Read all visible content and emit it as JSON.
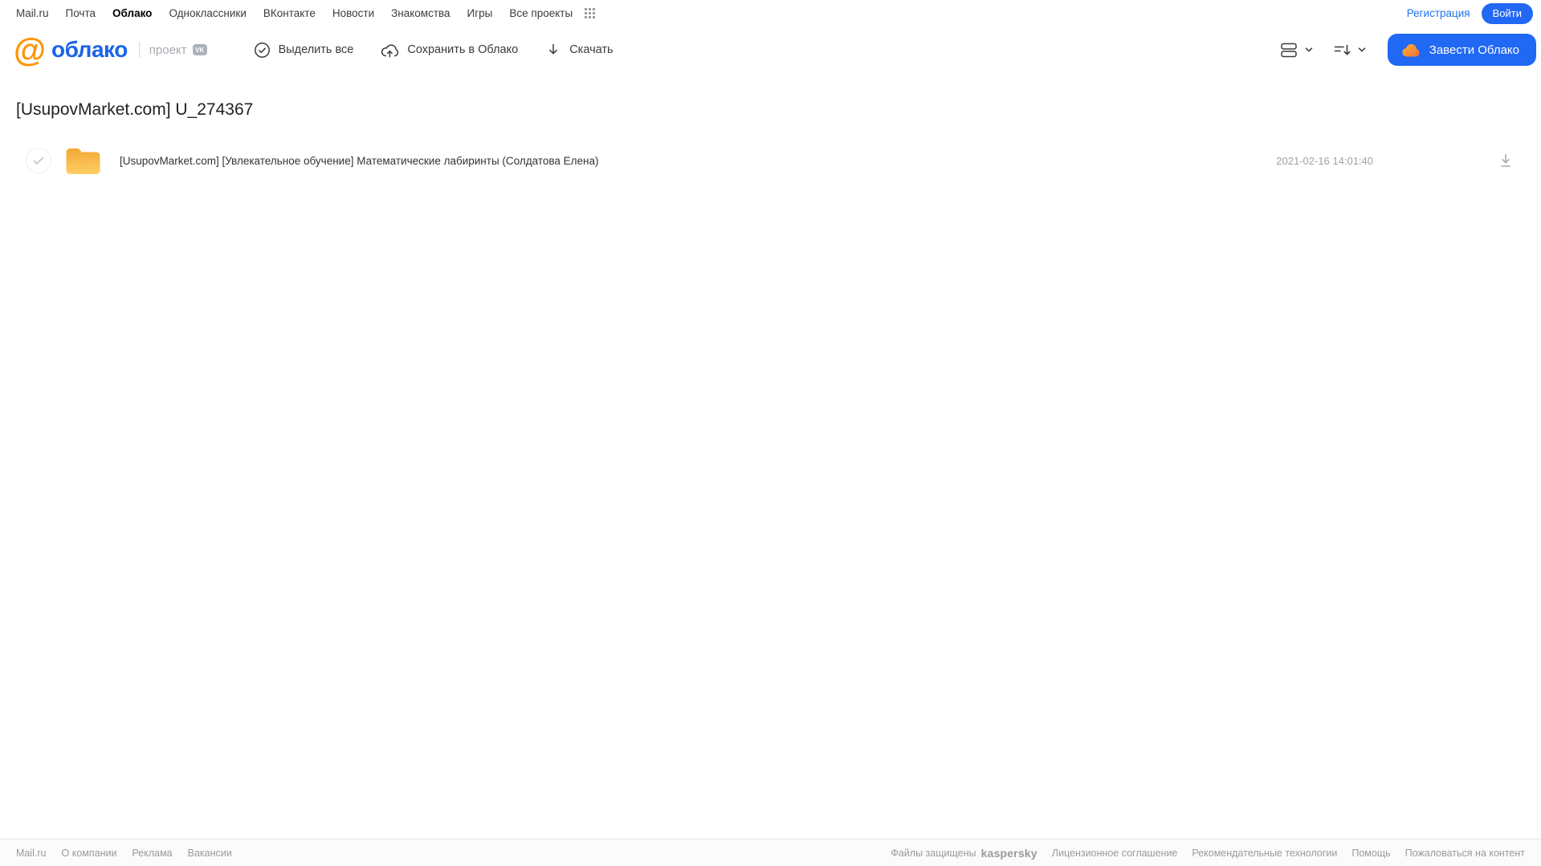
{
  "topbar": {
    "links": [
      "Mail.ru",
      "Почта",
      "Облако",
      "Одноклассники",
      "ВКонтакте",
      "Новости",
      "Знакомства",
      "Игры",
      "Все проекты"
    ],
    "active_link": "Облако",
    "registration": "Регистрация",
    "login": "Войти"
  },
  "header": {
    "logo_at": "@",
    "logo_text": "облако",
    "project_label": "проект",
    "vk_badge": "VK",
    "toolbar": {
      "select_all": "Выделить все",
      "save_to_cloud": "Сохранить в Облако",
      "download": "Скачать"
    },
    "get_cloud_button": "Завести Облако"
  },
  "main": {
    "title": "[UsupovMarket.com] U_274367",
    "files": [
      {
        "type": "folder",
        "name": "[UsupovMarket.com] [Увлекательное обучение] Математические лабиринты (Солдатова Елена)",
        "date": "2021-02-16 14:01:40"
      }
    ]
  },
  "footer": {
    "left_links": [
      "Mail.ru",
      "О компании",
      "Реклама",
      "Вакансии"
    ],
    "protected_label": "Файлы защищены",
    "kaspersky_brand": "kaspersky",
    "right_links": [
      "Лицензионное соглашение",
      "Рекомендательные технологии",
      "Помощь",
      "Пожаловаться на контент"
    ]
  },
  "colors": {
    "accent_blue": "#2168f5",
    "logo_blue": "#1a64e8",
    "logo_orange": "#ff9400",
    "kaspersky_green": "#009579",
    "folder_gradient_top": "#f3a832",
    "folder_gradient_bottom": "#ffce67",
    "muted_gray": "#9a9a9a"
  },
  "icons": {
    "apps_grid": "grid-3x3-dots",
    "select_all": "circled-check",
    "save_to_cloud": "cloud-upload",
    "download": "arrow-down",
    "view_mode": "list-view",
    "sort": "sort-arrow-down",
    "chevron": "chevron-down",
    "cloud_logo": "orange-cloud",
    "folder": "folder",
    "row_download": "arrow-down-underline",
    "checkbox": "circle-check"
  }
}
